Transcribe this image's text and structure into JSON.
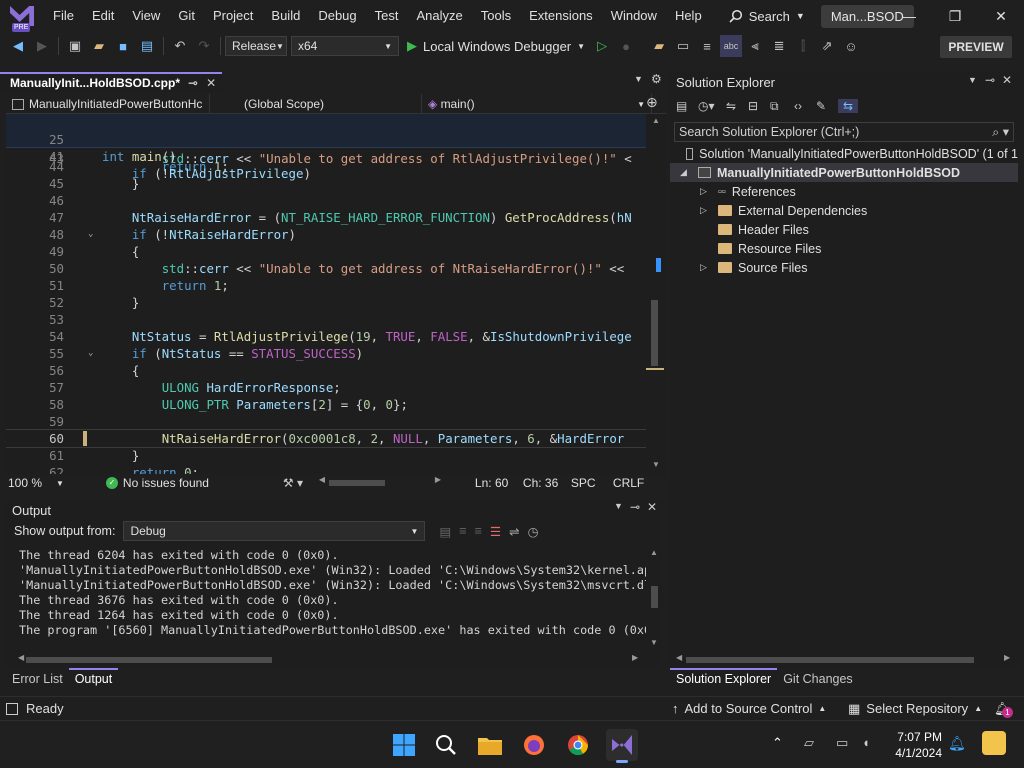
{
  "menu": {
    "items": [
      "File",
      "Edit",
      "View",
      "Git",
      "Project",
      "Build",
      "Debug",
      "Test",
      "Analyze",
      "Tools",
      "Extensions",
      "Window",
      "Help"
    ],
    "search_label": "Search",
    "window_title": "Man...BSOD",
    "logo_badge": "PRE"
  },
  "toolbar": {
    "config": "Release",
    "platform": "x64",
    "run_label": "Local Windows Debugger",
    "preview_label": "PREVIEW"
  },
  "editor": {
    "tab_label": "ManuallyInit...HoldBSOD.cpp*",
    "nav_project": "ManuallyInitiatedPowerButtonHc",
    "nav_scope": "(Global Scope)",
    "nav_member": "main()",
    "sticky_lines": [
      {
        "num": "25",
        "code": "int main()"
      },
      {
        "num": "41",
        "code": "    if (!RtlAdjustPrivilege)"
      }
    ],
    "lines": [
      {
        "num": "43",
        "code": "        std::cerr << \"Unable to get address of RtlAdjustPrivilege()!\" <"
      },
      {
        "num": "44",
        "code": "        return 1;"
      },
      {
        "num": "45",
        "code": "    }"
      },
      {
        "num": "46",
        "code": ""
      },
      {
        "num": "47",
        "code": "    NtRaiseHardError = (NT_RAISE_HARD_ERROR_FUNCTION) GetProcAddress(hN"
      },
      {
        "num": "48",
        "code": "    if (!NtRaiseHardError)"
      },
      {
        "num": "49",
        "code": "    {"
      },
      {
        "num": "50",
        "code": "        std::cerr << \"Unable to get address of NtRaiseHardError()!\" <<"
      },
      {
        "num": "51",
        "code": "        return 1;"
      },
      {
        "num": "52",
        "code": "    }"
      },
      {
        "num": "53",
        "code": ""
      },
      {
        "num": "54",
        "code": "    NtStatus = RtlAdjustPrivilege(19, TRUE, FALSE, &IsShutdownPrivilege"
      },
      {
        "num": "55",
        "code": "    if (NtStatus == STATUS_SUCCESS)"
      },
      {
        "num": "56",
        "code": "    {"
      },
      {
        "num": "57",
        "code": "        ULONG HardErrorResponse;"
      },
      {
        "num": "58",
        "code": "        ULONG_PTR Parameters[2] = {0, 0};"
      },
      {
        "num": "59",
        "code": ""
      },
      {
        "num": "60",
        "code": "        NtRaiseHardError(0xc0001c8, 2, NULL, Parameters, 6, &HardError"
      },
      {
        "num": "61",
        "code": "    }"
      },
      {
        "num": "62",
        "code": "    return 0;"
      }
    ],
    "zoom": "100 %",
    "issues": "No issues found",
    "ln": "Ln: 60",
    "ch": "Ch: 36",
    "spc": "SPC",
    "crlf": "CRLF"
  },
  "output": {
    "title": "Output",
    "show_from_label": "Show output from:",
    "source": "Debug",
    "lines": [
      "The thread 6204 has exited with code 0 (0x0).",
      "'ManuallyInitiatedPowerButtonHoldBSOD.exe' (Win32): Loaded 'C:\\Windows\\System32\\kernel.app",
      "'ManuallyInitiatedPowerButtonHoldBSOD.exe' (Win32): Loaded 'C:\\Windows\\System32\\msvcrt.dll",
      "The thread 3676 has exited with code 0 (0x0).",
      "The thread 1264 has exited with code 0 (0x0).",
      "The program '[6560] ManuallyInitiatedPowerButtonHoldBSOD.exe' has exited with code 0 (0x0"
    ]
  },
  "bottom_tabs": [
    "Error List",
    "Output"
  ],
  "solution": {
    "title": "Solution Explorer",
    "search_placeholder": "Search Solution Explorer (Ctrl+;)",
    "solution_label": "Solution 'ManuallyInitiatedPowerButtonHoldBSOD' (1 of 1",
    "project_label": "ManuallyInitiatedPowerButtonHoldBSOD",
    "nodes": [
      "References",
      "External Dependencies",
      "Header Files",
      "Resource Files",
      "Source Files"
    ],
    "tabs": [
      "Solution Explorer",
      "Git Changes"
    ]
  },
  "status": {
    "ready": "Ready",
    "source_control": "Add to Source Control",
    "repository": "Select Repository",
    "notif_count": "1"
  },
  "taskbar": {
    "time": "7:07 PM",
    "date": "4/1/2024"
  }
}
